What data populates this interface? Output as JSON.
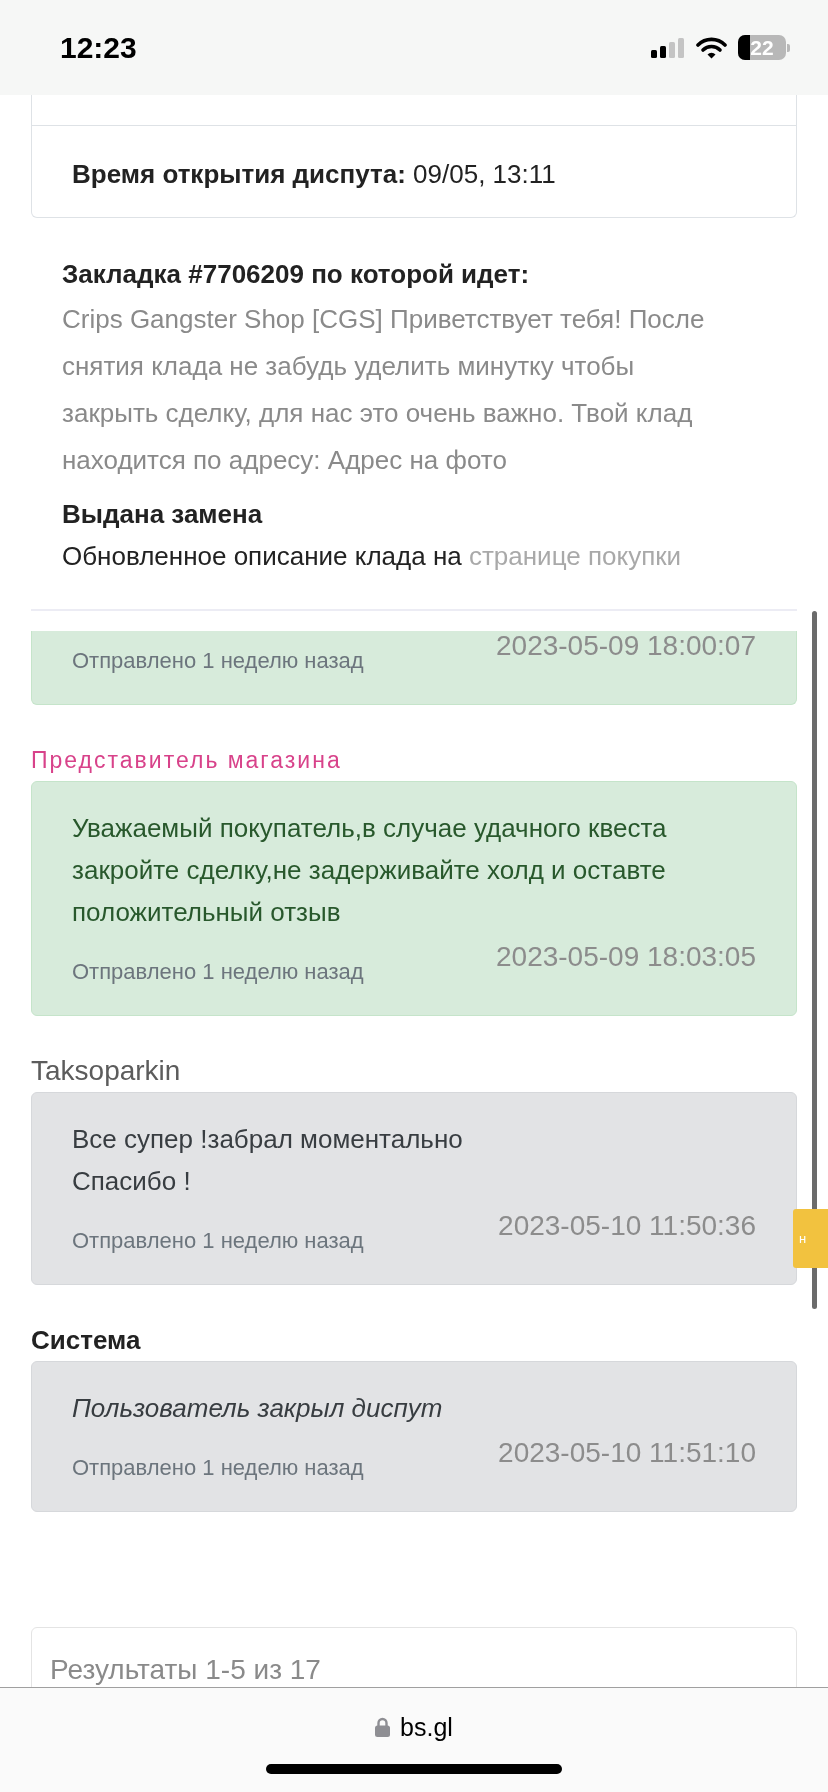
{
  "status_bar": {
    "time": "12:23",
    "battery": "22"
  },
  "dispute_card": {
    "label": "Время открытия диспута:",
    "value": "09/05, 13:11"
  },
  "stash": {
    "title": "Закладка #7706209 по которой идет:",
    "description": "Crips Gangster Shop [CGS] Приветствует тебя! После снятия клада не забудь уделить минутку чтобы закрыть сделку, для нас это очень важно. Твой клад находится по адресу: Адрес на фото",
    "replacement_title": "Выдана замена",
    "replacement_text": "Обновленное описание клада на",
    "replacement_link": "странице покупки"
  },
  "messages": [
    {
      "kind": "shop",
      "timestamp": "2023-05-09 18:00:07",
      "sent": "Отправлено 1 неделю назад"
    },
    {
      "kind": "shop",
      "sender": "Представитель магазина",
      "text": "Уважаемый покупатель,в случае удачного квеста закройте сделку,не задерживайте холд и оставте положительный отзыв",
      "timestamp": "2023-05-09 18:03:05",
      "sent": "Отправлено 1 неделю назад"
    },
    {
      "kind": "user",
      "sender": "Taksoparkin",
      "text": "Все супер !забрал моментально\nСпасибо !",
      "timestamp": "2023-05-10 11:50:36",
      "sent": "Отправлено 1 неделю назад"
    },
    {
      "kind": "system",
      "sender": "Система",
      "text": "Пользователь закрыл диспут",
      "timestamp": "2023-05-10 11:51:10",
      "sent": "Отправлено 1 неделю назад"
    }
  ],
  "side_tab": {
    "label": "н"
  },
  "pagination": {
    "summary": "Результаты 1-5 из 17"
  },
  "browser_bar": {
    "url": "bs.gl"
  }
}
